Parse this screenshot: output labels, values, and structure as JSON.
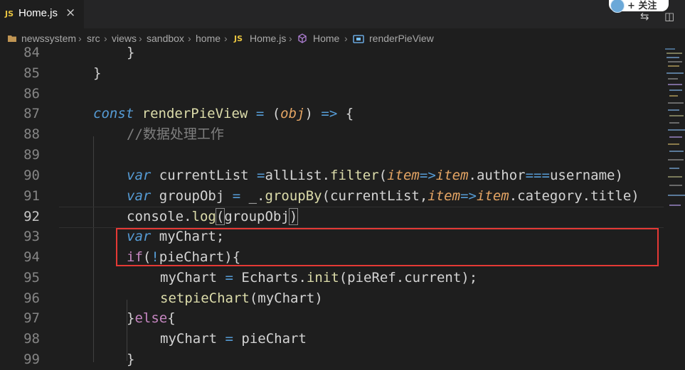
{
  "tab": {
    "lang_badge": "JS",
    "title": "Home.js",
    "close": "×"
  },
  "follow": {
    "label": "+ 关注"
  },
  "actions": {
    "compare": "⇆",
    "split": "◫"
  },
  "breadcrumb": {
    "project": "newssystem",
    "src": "src",
    "views": "views",
    "sandbox": "sandbox",
    "home": "home",
    "file_badge": "JS",
    "file": "Home.js",
    "component": "Home",
    "symbol": "renderPieView"
  },
  "lines": [
    {
      "num": "84",
      "text": "}"
    },
    {
      "num": "85",
      "text": "}"
    },
    {
      "num": "86",
      "text": ""
    },
    {
      "num": "87",
      "text": "const renderPieView = (obj) => {"
    },
    {
      "num": "88",
      "text": "//数据处理工作"
    },
    {
      "num": "89",
      "text": ""
    },
    {
      "num": "90",
      "text": "var currentList =allList.filter(item=>item.author===username)"
    },
    {
      "num": "91",
      "text": "var groupObj = _.groupBy(currentList,item=>item.category.title)"
    },
    {
      "num": "92",
      "text": "console.log(groupObj)"
    },
    {
      "num": "93",
      "text": "var myChart;"
    },
    {
      "num": "94",
      "text": "if(!pieChart){"
    },
    {
      "num": "95",
      "text": "myChart = Echarts.init(pieRef.current);"
    },
    {
      "num": "96",
      "text": "setpieChart(myChart)"
    },
    {
      "num": "97",
      "text": "}else{"
    },
    {
      "num": "98",
      "text": "myChart = pieChart"
    },
    {
      "num": "99",
      "text": "}"
    }
  ],
  "colors": {
    "background": "#1e1e1e",
    "keyword": "#569cd6",
    "function": "#dcdcaa",
    "variable": "#9cdcfe",
    "parameter": "#e5a564",
    "control": "#c586c0",
    "highlight_box": "#e53935"
  }
}
